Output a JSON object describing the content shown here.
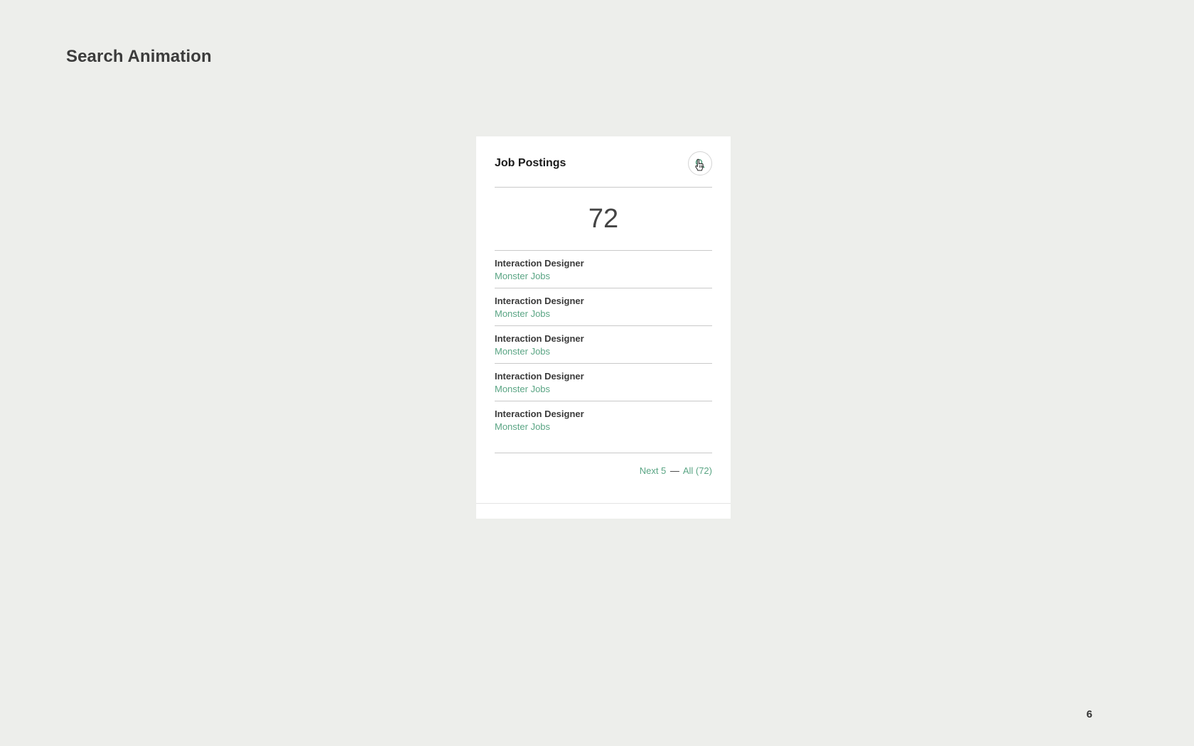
{
  "page": {
    "title": "Search Animation",
    "slide_number": "6"
  },
  "card": {
    "title": "Job Postings",
    "count": "72",
    "search_icon": "search-icon",
    "cursor_icon": "hand-pointer-icon",
    "jobs": [
      {
        "title": "Interaction Designer",
        "company": "Monster Jobs"
      },
      {
        "title": "Interaction Designer",
        "company": "Monster Jobs"
      },
      {
        "title": "Interaction Designer",
        "company": "Monster Jobs"
      },
      {
        "title": "Interaction Designer",
        "company": "Monster Jobs"
      },
      {
        "title": "Interaction Designer",
        "company": "Monster Jobs"
      }
    ],
    "pager": {
      "next_label": "Next 5",
      "separator": "—",
      "all_label": "All (72)"
    }
  },
  "colors": {
    "background": "#edeeeb",
    "card": "#ffffff",
    "accent": "#5aa584",
    "divider": "#c9c9c9"
  }
}
